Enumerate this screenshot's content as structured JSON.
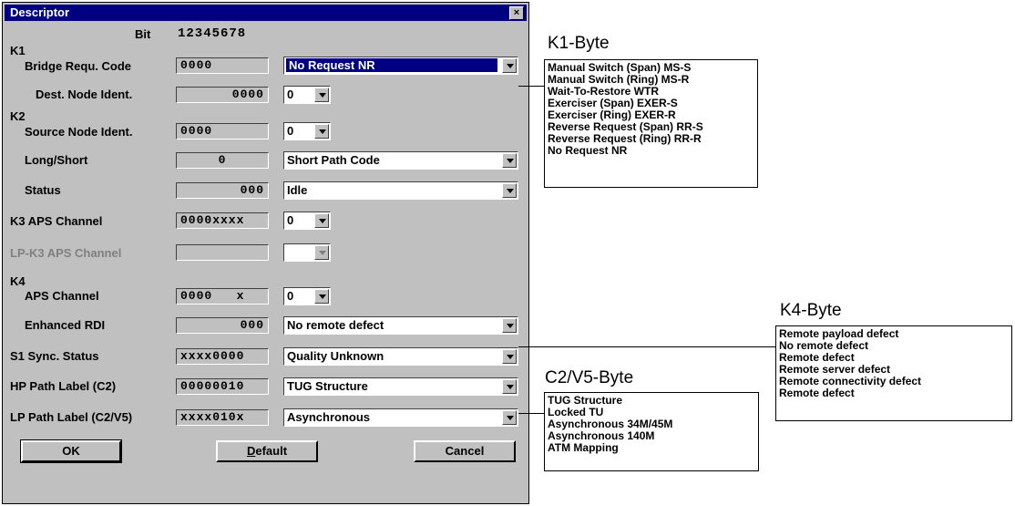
{
  "window": {
    "title": "Descriptor",
    "close_label": "×"
  },
  "bit_header": {
    "label": "Bit",
    "digits": "12345678"
  },
  "groups": {
    "k1": "K1",
    "k2": "K2",
    "k4": "K4"
  },
  "rows": {
    "bridge": {
      "label": "Bridge Requ. Code",
      "value": "0000",
      "combo": "No Request NR"
    },
    "dest": {
      "label": "Dest. Node Ident.",
      "value": "0000",
      "combo": "0"
    },
    "source": {
      "label": "Source Node Ident.",
      "value": "0000",
      "combo": "0"
    },
    "longshort": {
      "label": "Long/Short",
      "value": "0",
      "combo": "Short Path Code"
    },
    "status": {
      "label": "Status",
      "value": "000",
      "combo": "Idle"
    },
    "k3": {
      "label": "K3 APS Channel",
      "value": "0000xxxx",
      "combo": "0"
    },
    "lpk3": {
      "label": "LP-K3 APS Channel",
      "value": "",
      "combo": ""
    },
    "k4aps": {
      "label": "APS Channel",
      "value": "0000   x",
      "combo": "0"
    },
    "rdi": {
      "label": "Enhanced RDI",
      "value": "000",
      "combo": "No remote defect"
    },
    "s1": {
      "label": "S1 Sync. Status",
      "value": "xxxx0000",
      "combo": "Quality Unknown"
    },
    "hp": {
      "label": "HP Path Label (C2)",
      "value": "00000010",
      "combo": "TUG Structure"
    },
    "lp": {
      "label": "LP Path Label (C2/V5)",
      "value": "xxxx010x",
      "combo": "Asynchronous"
    }
  },
  "buttons": {
    "ok": "OK",
    "default": "Default",
    "cancel": "Cancel"
  },
  "k1_list": {
    "heading": "K1-Byte",
    "items": [
      "Manual Switch (Span) MS-S",
      "Manual Switch (Ring) MS-R",
      "Wait-To-Restore WTR",
      "Exerciser (Span) EXER-S",
      "Exerciser (Ring) EXER-R",
      "Reverse Request (Span) RR-S",
      "Reverse Request (Ring) RR-R",
      "No Request NR"
    ]
  },
  "k4_list": {
    "heading": "K4-Byte",
    "items": [
      "Remote payload defect",
      "No remote defect",
      "Remote defect",
      "Remote server defect",
      "Remote connectivity defect",
      "Remote defect"
    ]
  },
  "c2_list": {
    "heading": "C2/V5-Byte",
    "items": [
      "TUG Structure",
      "Locked TU",
      "Asynchronous 34M/45M",
      "Asynchronous 140M",
      "ATM Mapping"
    ]
  },
  "colors": {
    "titlebar": "#000080",
    "dialog": "#c0c0c0",
    "selection": "#000080"
  }
}
